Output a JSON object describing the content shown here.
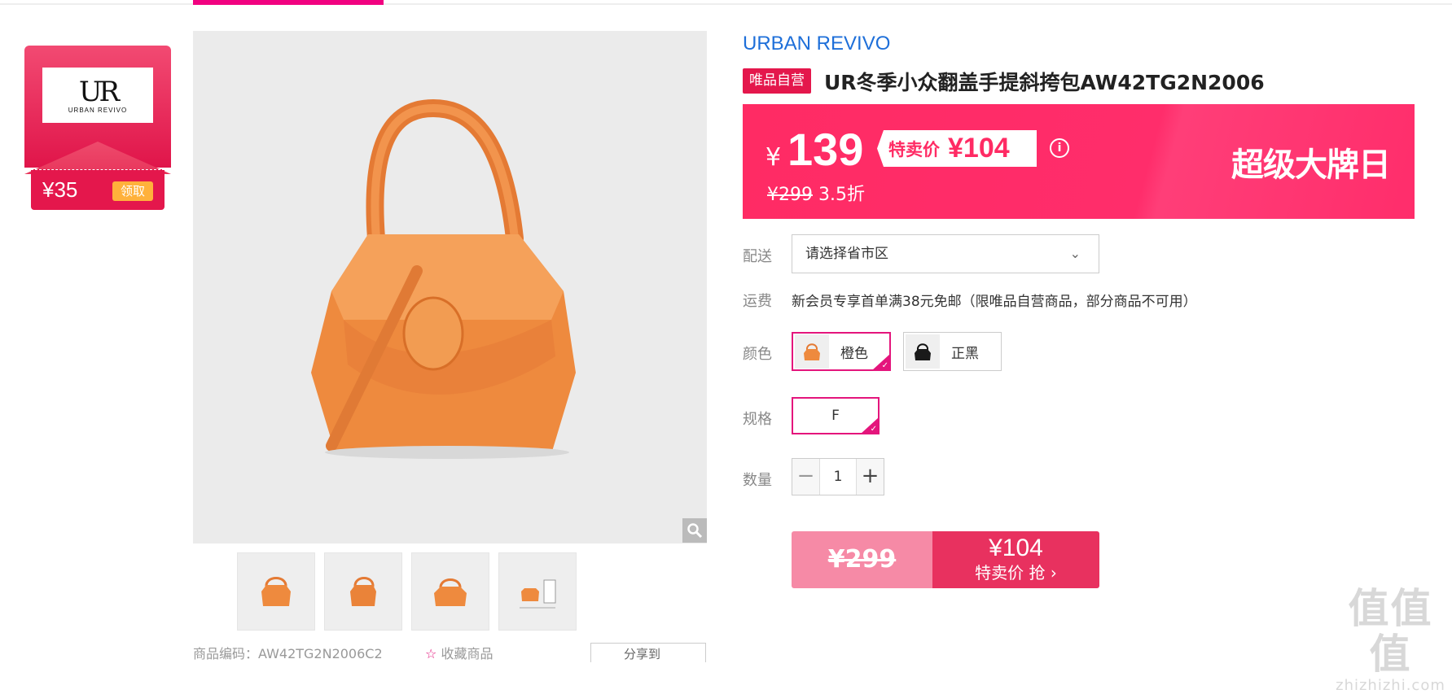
{
  "coupon": {
    "amount": "¥35",
    "claim_label": "领取",
    "logo_mark": "UR",
    "logo_text": "URBAN REVIVO"
  },
  "product": {
    "brand": "URBAN REVIVO",
    "self_badge": "唯品自营",
    "title": "UR冬季小众翻盖手提斜挎包AW42TG2N2006"
  },
  "price": {
    "currency": "¥",
    "current": "139",
    "sale_label": "特卖价",
    "sale_value": "¥104",
    "original": "¥299",
    "discount": "3.5折",
    "event": "超级大牌日",
    "accent_color": "#ff2b64"
  },
  "delivery": {
    "label": "配送",
    "placeholder": "请选择省市区"
  },
  "shipping": {
    "label": "运费",
    "text": "新会员专享首单满38元免邮（限唯品自营商品，部分商品不可用）"
  },
  "color": {
    "label": "颜色",
    "options": [
      {
        "name": "橙色",
        "selected": true
      },
      {
        "name": "正黑",
        "selected": false
      }
    ]
  },
  "spec": {
    "label": "规格",
    "options": [
      {
        "name": "F",
        "selected": true
      }
    ]
  },
  "quantity": {
    "label": "数量",
    "value": "1",
    "minus": "−",
    "plus": "+"
  },
  "buy": {
    "original": "¥299",
    "price": "¥104",
    "action": "特卖价 抢 ›",
    "accent_color": "#e8315f"
  },
  "below": {
    "code": "商品编码：AW42TG2N2006C2",
    "collect": "收藏商品",
    "share": "分享到"
  },
  "watermark": {
    "line1": "值值值",
    "line2": "zhizhizhi.com"
  }
}
